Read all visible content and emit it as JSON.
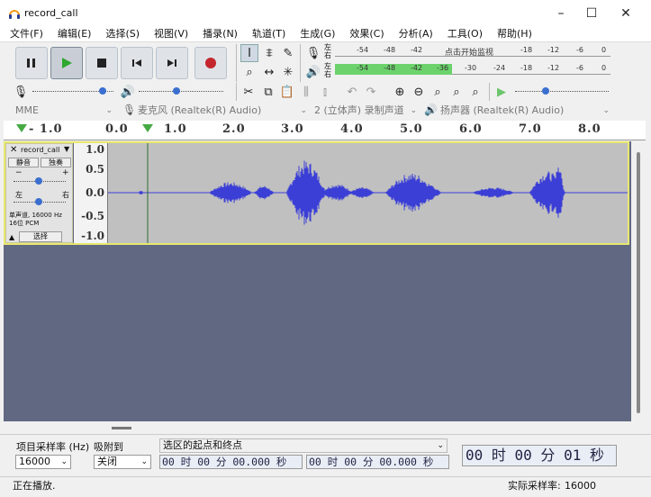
{
  "window": {
    "title": "record_call",
    "minimize": "–",
    "maximize": "☐",
    "close": "✕"
  },
  "menu": [
    "文件(F)",
    "编辑(E)",
    "选择(S)",
    "视图(V)",
    "播录(N)",
    "轨道(T)",
    "生成(G)",
    "效果(C)",
    "分析(A)",
    "工具(O)",
    "帮助(H)"
  ],
  "meters": {
    "record_lr_left": "左",
    "record_lr_right": "右",
    "play_lr_left": "左",
    "play_lr_right": "右",
    "record_ticks": [
      "-54",
      "-48",
      "-42"
    ],
    "record_prompt": "点击开始监视",
    "record_ticks2": [
      "-18",
      "-12",
      "-6",
      "0"
    ],
    "play_ticks": [
      "-54",
      "-48",
      "-42",
      "-36",
      "-30",
      "-24",
      "-18",
      "-12",
      "-6",
      "0"
    ]
  },
  "devices": {
    "host": "MME",
    "mic_input": "麦克风 (Realtek(R) Audio)",
    "channels": "2 (立体声) 录制声道",
    "speaker_output": "扬声器 (Realtek(R) Audio)"
  },
  "ruler": [
    "- 1.0",
    "0.0",
    "1.0",
    "2.0",
    "3.0",
    "4.0",
    "5.0",
    "6.0",
    "7.0",
    "8.0"
  ],
  "track": {
    "name": "record_call",
    "mute": "静音",
    "solo": "独奏",
    "pan_left": "左",
    "pan_right": "右",
    "info_line1": "单声道, 16000 Hz",
    "info_line2": "16位 PCM",
    "select": "选择",
    "scale": [
      "1.0",
      "0.5",
      "0.0",
      "-0.5",
      "-1.0"
    ],
    "wave_color": "#3b3fd6",
    "cursor_color": "#2e6b2e"
  },
  "selection": {
    "rate_label": "项目采样率 (Hz)",
    "rate_value": "16000",
    "snap_label": "吸附到",
    "snap_value": "关闭",
    "mode_label": "选区的起点和终点",
    "start_time": "00 时 00 分 00.000 秒",
    "end_time": "00 时 00 分 00.000 秒",
    "audio_position": "00 时 00 分 01 秒"
  },
  "status": {
    "left": "正在播放.",
    "rate_label": "实际采样率:",
    "rate_value": "16000"
  },
  "colors": {
    "accent_play": "#2fa82f",
    "record": "#c4262e",
    "track_bg": "#616882"
  }
}
